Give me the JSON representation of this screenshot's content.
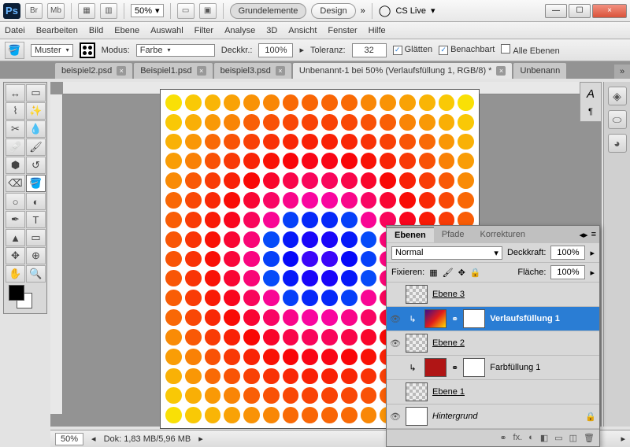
{
  "title": {
    "ps": "Ps",
    "br": "Br",
    "mb": "Mb",
    "zoom": "50%",
    "grundelemente": "Grundelemente",
    "design": "Design",
    "cslive": "CS Live"
  },
  "menu": [
    "Datei",
    "Bearbeiten",
    "Bild",
    "Ebene",
    "Auswahl",
    "Filter",
    "Analyse",
    "3D",
    "Ansicht",
    "Fenster",
    "Hilfe"
  ],
  "opts": {
    "muster_label": "Muster",
    "modus_label": "Modus:",
    "modus_value": "Farbe",
    "deckkr_label": "Deckkr.:",
    "deckkr_value": "100%",
    "toleranz_label": "Toleranz:",
    "toleranz_value": "32",
    "glaetten": "Glätten",
    "benachbart": "Benachbart",
    "alle": "Alle Ebenen"
  },
  "tabs": [
    {
      "label": "beispiel2.psd",
      "active": false
    },
    {
      "label": "Beispiel1.psd",
      "active": false
    },
    {
      "label": "beispiel3.psd",
      "active": false
    },
    {
      "label": "Unbenannt-1 bei 50% (Verlaufsfüllung 1, RGB/8) *",
      "active": true
    },
    {
      "label": "Unbenann",
      "active": false
    }
  ],
  "layers_panel": {
    "tabs": [
      "Ebenen",
      "Pfade",
      "Korrekturen"
    ],
    "blend": "Normal",
    "deckkraft_label": "Deckkraft:",
    "deckkraft_value": "100%",
    "fixieren": "Fixieren:",
    "flaeche_label": "Fläche:",
    "flaeche_value": "100%",
    "layers": [
      {
        "name": "Ebene 3",
        "vis": false,
        "sel": false,
        "thumb": "check",
        "u": true
      },
      {
        "name": "Verlaufsfüllung 1",
        "vis": true,
        "sel": true,
        "thumb": "grad",
        "mask": true,
        "bold": true
      },
      {
        "name": "Ebene 2",
        "vis": true,
        "sel": false,
        "thumb": "check",
        "u": true
      },
      {
        "name": "Farbfüllung 1",
        "vis": false,
        "sel": false,
        "thumb": "red",
        "mask": true
      },
      {
        "name": "Ebene 1",
        "vis": false,
        "sel": false,
        "thumb": "check",
        "u": true
      },
      {
        "name": "Hintergrund",
        "vis": true,
        "sel": false,
        "thumb": "white",
        "italic": true,
        "lock": true
      }
    ]
  },
  "status": {
    "zoom": "50%",
    "dok": "Dok: 1,83 MB/5,96 MB"
  },
  "icons": {
    "chev": "▾",
    "right": "▸",
    "x": "×",
    "eye": "👁",
    "lock": "🔒",
    "dblchev": "»",
    "search": "🔍",
    "cslive": "◯",
    "min": "—",
    "max": "☐",
    "tri": "▸",
    "link": "⚭",
    "fx": "fx.",
    "mask": "◐",
    "adj": "◧",
    "group": "▭",
    "new": "◫",
    "trash": "🗑"
  }
}
